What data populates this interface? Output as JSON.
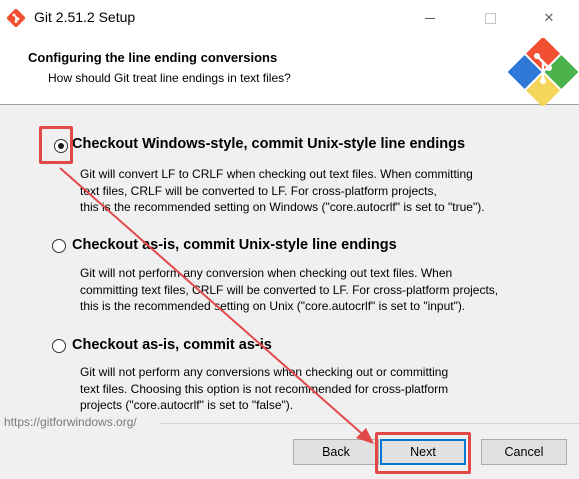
{
  "window": {
    "title": "Git 2.51.2 Setup",
    "controls": {
      "minimize": "minimize",
      "maximize": "maximize",
      "close": "✕"
    }
  },
  "header": {
    "title": "Configuring the line ending conversions",
    "subtitle": "How should Git treat line endings in text files?"
  },
  "options": [
    {
      "label": "Checkout Windows-style, commit Unix-style line endings",
      "selected": true,
      "description": [
        "Git will convert LF to CRLF when checking out text files. When committing",
        "text files, CRLF will be converted to LF. For cross-platform projects,",
        "this is the recommended setting on Windows (\"core.autocrlf\" is set to \"true\")."
      ]
    },
    {
      "label": "Checkout as-is, commit Unix-style line endings",
      "selected": false,
      "description": [
        "Git will not perform any conversion when checking out text files. When",
        "committing text files, CRLF will be converted to LF. For cross-platform projects,",
        "this is the recommended setting on Unix (\"core.autocrlf\" is set to \"input\")."
      ]
    },
    {
      "label": "Checkout as-is, commit as-is",
      "selected": false,
      "description": [
        "Git will not perform any conversions when checking out or committing",
        "text files. Choosing this option is not recommended for cross-platform",
        "projects (\"core.autocrlf\" is set to \"false\")."
      ]
    }
  ],
  "footer": {
    "url": "https://gitforwindows.org/",
    "back_label": "Back",
    "next_label": "Next",
    "cancel_label": "Cancel"
  },
  "annotation_color": "#e34848",
  "icons": [
    "git-app-icon",
    "git-logo-icon",
    "annotation-arrow-icon"
  ]
}
